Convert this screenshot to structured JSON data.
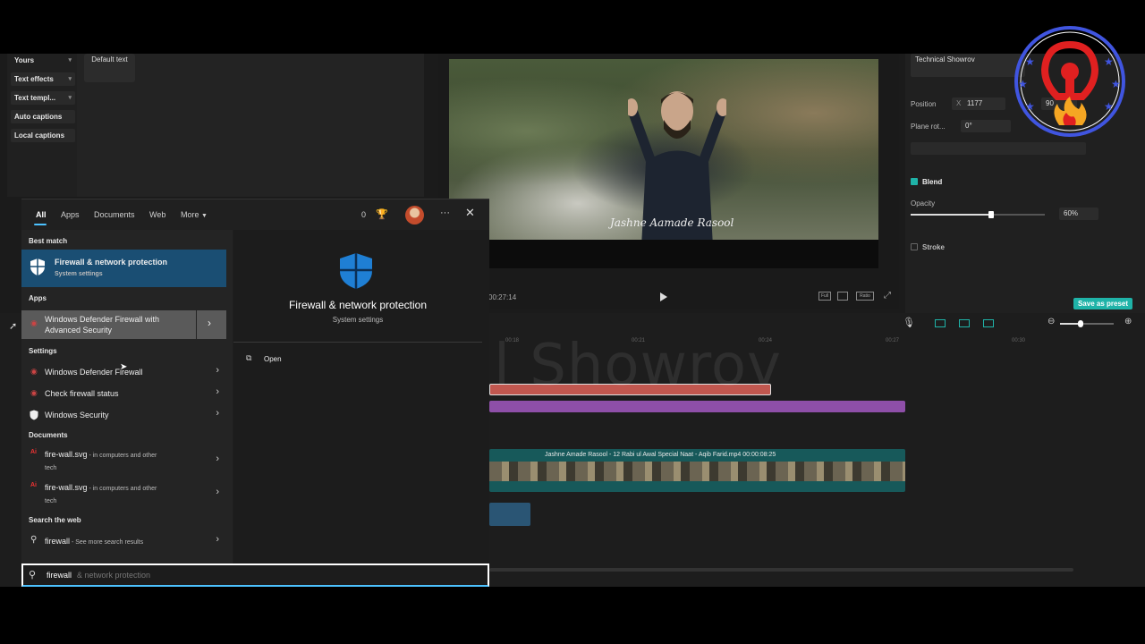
{
  "editor": {
    "left_menu": [
      {
        "label": "Yours",
        "has_chevron": true
      },
      {
        "label": "Text effects",
        "has_chevron": true
      },
      {
        "label": "Text templ...",
        "has_chevron": true
      },
      {
        "label": "Auto captions",
        "has_chevron": false
      },
      {
        "label": "Local captions",
        "has_chevron": false
      }
    ],
    "default_text": "Default text",
    "preview": {
      "caption": "Jashne Aamade Rasool",
      "time": "00:27:14",
      "buttons": [
        "Full",
        "Ratio"
      ]
    },
    "properties": {
      "text_name": "Technical Showrov",
      "position_label": "Position",
      "position_x_label": "X",
      "position_x": "1177",
      "position_y": "90",
      "plane_rot_label": "Plane rot...",
      "plane_rot_value": "0°",
      "blend_label": "Blend",
      "opacity_label": "Opacity",
      "opacity_value": "60%",
      "opacity_fraction": 0.6,
      "stroke_label": "Stroke",
      "save_preset": "Save as preset"
    },
    "timeline": {
      "ticks": [
        "00:18",
        "00:21",
        "00:24",
        "00:27",
        "00:30"
      ],
      "video_clip_label": "Jashne Amade Rasool - 12 Rabi ul Awal Special Naat - Aqib Farid.mp4  00:00:08:25"
    }
  },
  "search": {
    "tabs": [
      "All",
      "Apps",
      "Documents",
      "Web",
      "More"
    ],
    "points": "0",
    "sections": {
      "best_match": "Best match",
      "apps": "Apps",
      "settings": "Settings",
      "documents": "Documents",
      "web": "Search the web"
    },
    "best_match": {
      "title": "Firewall & network protection",
      "subtitle": "System settings"
    },
    "apps": [
      {
        "title": "Windows Defender Firewall with",
        "title2": "Advanced Security"
      }
    ],
    "settings": [
      {
        "title": "Windows Defender Firewall"
      },
      {
        "title": "Check firewall status"
      },
      {
        "title": "Windows Security"
      }
    ],
    "documents": [
      {
        "title": "fire-wall.svg",
        "meta": " - in computers and other",
        "meta2": "tech"
      },
      {
        "title": "fire-wall.svg",
        "meta": " - in computers and other",
        "meta2": "tech"
      }
    ],
    "web": {
      "title": "firewall",
      "meta": " - See more search results"
    },
    "detail": {
      "title": "Firewall & network protection",
      "subtitle": "System settings",
      "action": "Open"
    },
    "query_typed": "firewall",
    "query_ghost": " & network protection"
  },
  "overlay": {
    "watermark": "Technical Showrov"
  },
  "colors": {
    "accent": "#4cc2ff",
    "best_match_bg": "#1a4e73",
    "preset": "#1fb3a8"
  }
}
